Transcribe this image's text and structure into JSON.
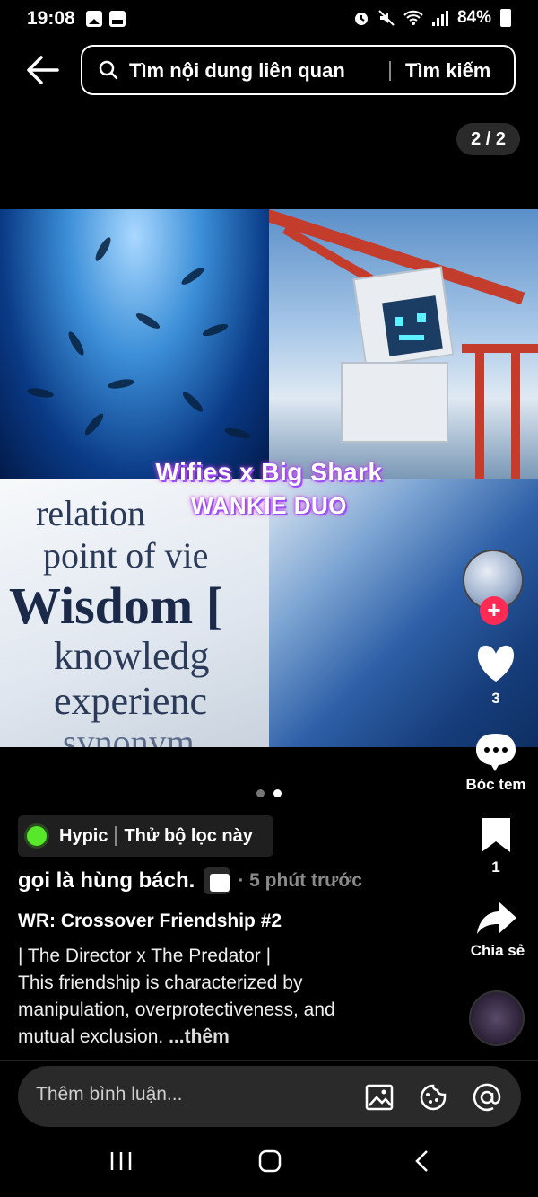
{
  "status_bar": {
    "time": "19:08",
    "battery": "84%"
  },
  "search": {
    "placeholder": "Tìm nội dung liên quan",
    "button": "Tìm kiếm"
  },
  "image_counter": "2 / 2",
  "collage": {
    "overlay_line1": "Wifies x Big Shark",
    "overlay_line2": "WANKIE DUO",
    "dict_words": [
      "relation",
      "point of vie",
      "Wisdom [",
      "knowledg",
      "experienc",
      "synonym"
    ]
  },
  "carousel": {
    "total": 2,
    "active": 2
  },
  "rail": {
    "like_count": "3",
    "comment_label": "Bóc tem",
    "save_count": "1",
    "share_label": "Chia sẻ"
  },
  "filter": {
    "app": "Hypic",
    "action": "Thử bộ lọc này"
  },
  "post": {
    "author": "gọi là hùng bách.",
    "time": "· 5 phút trước",
    "title": "WR: Crossover Friendship #2",
    "line1": "| The Director x The Predator |",
    "line2": "This friendship is characterized by",
    "line3": "manipulation, overprotectiveness, and",
    "line4": "mutual exclusion. ",
    "more": "...thêm"
  },
  "comment_bar": {
    "placeholder": "Thêm bình luận..."
  },
  "colors": {
    "accent_plus": "#ff2b55",
    "filter_dot": "#58e82a"
  },
  "icons": [
    "back-arrow-icon",
    "search-icon",
    "heart-icon",
    "comment-icon",
    "bookmark-icon",
    "share-icon",
    "image-icon",
    "emoji-icon",
    "mention-icon"
  ]
}
